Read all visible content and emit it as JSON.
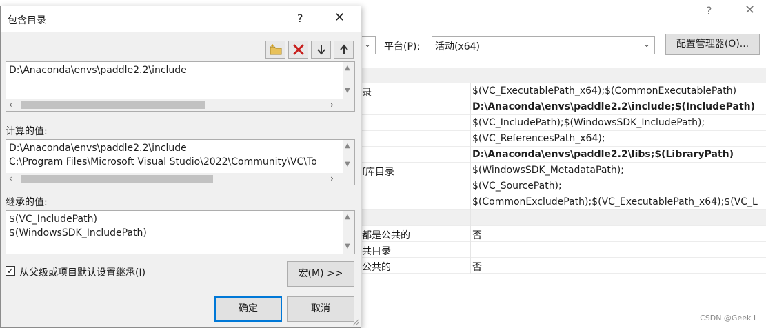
{
  "background": {
    "help_glyph": "?",
    "close_glyph": "✕",
    "platform_label": "平台(P):",
    "platform_value": "活动(x64)",
    "config_button": "配置管理器(O)...",
    "rows": [
      {
        "name": "录",
        "value": "$(VC_ExecutablePath_x64);$(CommonExecutablePath)",
        "bold": false
      },
      {
        "name": "",
        "value": "D:\\Anaconda\\envs\\paddle2.2\\include;$(IncludePath)",
        "bold": true
      },
      {
        "name": "",
        "value": "$(VC_IncludePath);$(WindowsSDK_IncludePath);",
        "bold": false
      },
      {
        "name": "",
        "value": "$(VC_ReferencesPath_x64);",
        "bold": false
      },
      {
        "name": "",
        "value": "D:\\Anaconda\\envs\\paddle2.2\\libs;$(LibraryPath)",
        "bold": true
      },
      {
        "name": "f库目录",
        "value": "$(WindowsSDK_MetadataPath);",
        "bold": false
      },
      {
        "name": "",
        "value": "$(VC_SourcePath);",
        "bold": false
      },
      {
        "name": "",
        "value": "$(CommonExcludePath);$(VC_ExecutablePath_x64);$(VC_L",
        "bold": false
      },
      {
        "name": "",
        "value": "",
        "bold": false,
        "section": true
      },
      {
        "name": "都是公共的",
        "value": "否",
        "bold": false
      },
      {
        "name": "共目录",
        "value": "",
        "bold": false
      },
      {
        "name": "公共的",
        "value": "否",
        "bold": false
      }
    ],
    "watermark": "CSDN @Geek L"
  },
  "dialog": {
    "title": "包含目录",
    "help_glyph": "?",
    "close_glyph": "✕",
    "toolbar": {
      "new_line": "new-folder-icon",
      "delete": "delete-icon",
      "move_down": "arrow-down-icon",
      "move_up": "arrow-up-icon"
    },
    "edit_lines": [
      "D:\\Anaconda\\envs\\paddle2.2\\include"
    ],
    "computed_label": "计算的值:",
    "computed_lines": [
      "D:\\Anaconda\\envs\\paddle2.2\\include",
      "C:\\Program Files\\Microsoft Visual Studio\\2022\\Community\\VC\\To"
    ],
    "inherited_label": "继承的值:",
    "inherited_lines": [
      "$(VC_IncludePath)",
      "$(WindowsSDK_IncludePath)"
    ],
    "inherit_checkbox": {
      "label": "从父级或项目默认设置继承(I)",
      "checked": true,
      "glyph": "✓"
    },
    "macro_button": "宏(M) >>",
    "ok_button": "确定",
    "cancel_button": "取消"
  }
}
